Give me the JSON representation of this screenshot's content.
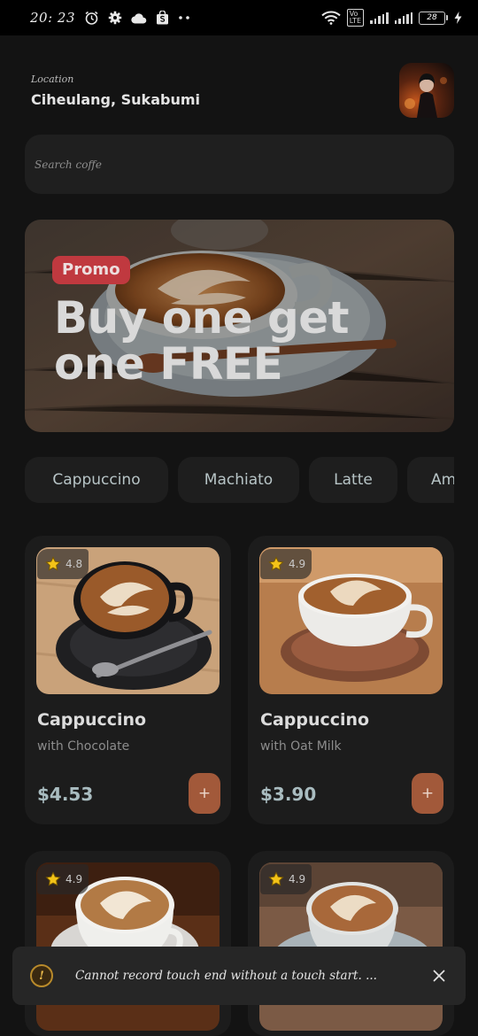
{
  "status_bar": {
    "time": "20: 23",
    "battery": "28"
  },
  "header": {
    "location_label": "Location",
    "location_value": "Ciheulang, Sukabumi"
  },
  "search": {
    "placeholder": "Search coffe"
  },
  "promo": {
    "tag": "Promo",
    "title": "Buy one get one FREE"
  },
  "categories": [
    "Cappuccino",
    "Machiato",
    "Latte",
    "Am"
  ],
  "products": [
    {
      "rating": "4.8",
      "name": "Cappuccino",
      "subtitle": "with Chocolate",
      "price": "$4.53",
      "add_label": "+"
    },
    {
      "rating": "4.9",
      "name": "Cappuccino",
      "subtitle": "with Oat Milk",
      "price": "$3.90",
      "add_label": "+"
    },
    {
      "rating": "4.9"
    },
    {
      "rating": "4.9"
    }
  ],
  "toast": {
    "icon": "!",
    "message": "Cannot record touch end without a touch start. ..."
  },
  "colors": {
    "background": "#131313",
    "surface": "#1c1c1c",
    "accent": "#a2593a",
    "promo_tag": "#c0393f",
    "price": "#a9bcc0"
  }
}
